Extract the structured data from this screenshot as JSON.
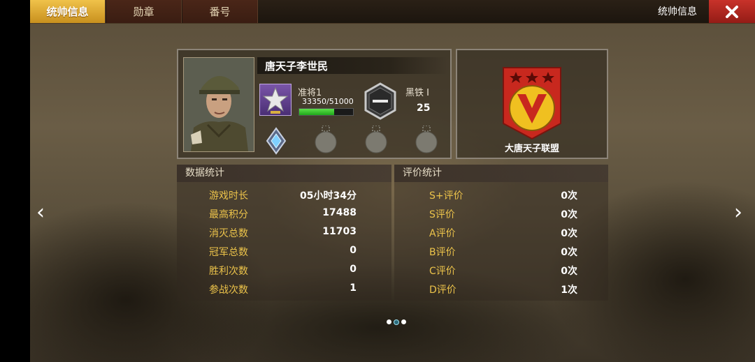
{
  "tabs": [
    {
      "label": "统帅信息",
      "active": true
    },
    {
      "label": "勋章",
      "active": false
    },
    {
      "label": "番号",
      "active": false
    }
  ],
  "header": {
    "title": "统帅信息"
  },
  "commander": {
    "name": "唐天子李世民",
    "rank": "准将1",
    "xp_text": "33350/51000",
    "xp_progress": 0.654,
    "tier": "黑铁 I",
    "tier_level": "25"
  },
  "alliance": {
    "name": "大唐天子联盟"
  },
  "data_stats": {
    "title": "数据统计",
    "rows": [
      {
        "label": "游戏时长",
        "value": "05小时34分"
      },
      {
        "label": "最高积分",
        "value": "17488"
      },
      {
        "label": "消灭总数",
        "value": "11703"
      },
      {
        "label": "冠军总数",
        "value": "0"
      },
      {
        "label": "胜利次数",
        "value": "0"
      },
      {
        "label": "参战次数",
        "value": "1"
      }
    ]
  },
  "rating_stats": {
    "title": "评价统计",
    "rows": [
      {
        "label": "S+评价",
        "value": "0次"
      },
      {
        "label": "S评价",
        "value": "0次"
      },
      {
        "label": "A评价",
        "value": "0次"
      },
      {
        "label": "B评价",
        "value": "0次"
      },
      {
        "label": "C评价",
        "value": "0次"
      },
      {
        "label": "D评价",
        "value": "1次"
      }
    ]
  },
  "nav": {
    "prev": "‹",
    "next": "›"
  },
  "pager": {
    "pages": 3,
    "current": 1
  },
  "colors": {
    "accent_gold": "#f0c24a",
    "close_red": "#c8322a",
    "label_gold": "#ecc34a",
    "xp_green": "#3cc832"
  },
  "icons": [
    "close-icon",
    "rank-star-icon",
    "tier-hexagon-icon",
    "diamond-medal-icon",
    "empty-medal-slot-icon",
    "alliance-emblem-icon",
    "chevron-left-icon",
    "chevron-right-icon"
  ]
}
